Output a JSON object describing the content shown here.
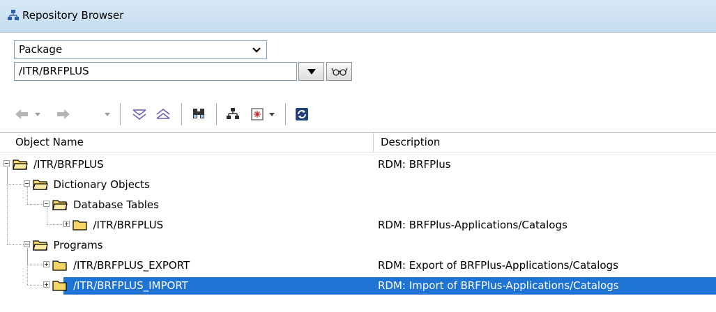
{
  "window": {
    "title": "Repository Browser",
    "title_icon": "hierarchy-icon"
  },
  "selector": {
    "object_type": "Package",
    "object_name": "/ITR/BRFPLUS"
  },
  "toolbar": {
    "icons": [
      "back-arrow-icon",
      "back-dropdown-icon",
      "forward-arrow-icon",
      "forward-dropdown-icon",
      "expand-all-icon",
      "collapse-all-icon",
      "find-icon",
      "hierarchy-icon",
      "object-list-icon",
      "object-list-dropdown-icon",
      "refresh-icon"
    ]
  },
  "columns": {
    "object_name": "Object Name",
    "description": "Description"
  },
  "tree": [
    {
      "label": "/ITR/BRFPLUS",
      "description": "RDM: BRFPlus",
      "level": 0,
      "node": "expanded"
    },
    {
      "label": "Dictionary Objects",
      "description": "",
      "level": 1,
      "node": "expanded"
    },
    {
      "label": "Database Tables",
      "description": "",
      "level": 2,
      "node": "expanded"
    },
    {
      "label": "/ITR/BRFPLUS",
      "description": "RDM: BRFPlus-Applications/Catalogs",
      "level": 3,
      "node": "collapsed"
    },
    {
      "label": "Programs",
      "description": "",
      "level": 1,
      "node": "expanded"
    },
    {
      "label": "/ITR/BRFPLUS_EXPORT",
      "description": "RDM: Export of BRFPlus-Applications/Catalogs",
      "level": 2,
      "node": "collapsed"
    },
    {
      "label": "/ITR/BRFPLUS_IMPORT",
      "description": "RDM: Import of BRFPlus-Applications/Catalogs",
      "level": 2,
      "node": "collapsed",
      "selected": true
    }
  ],
  "colors": {
    "title_bg": "#c9dff1",
    "selection": "#1e73d3",
    "folder": "#f5d565"
  }
}
